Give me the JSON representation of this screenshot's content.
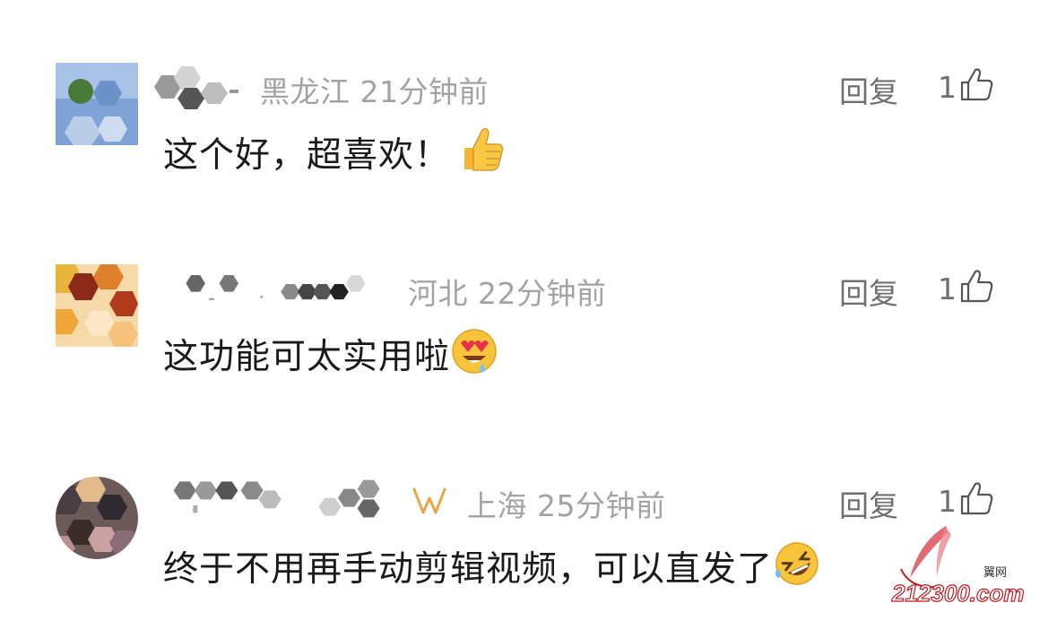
{
  "comments": [
    {
      "location": "黑龙江",
      "time": "21分钟前",
      "text": "这个好，超喜欢！",
      "emoji": "thumbs-up-emoji",
      "reply_label": "回复",
      "likes": "1"
    },
    {
      "location": "河北",
      "time": "22分钟前",
      "text": "这功能可太实用啦",
      "emoji": "heart-eyes-drooling-emoji",
      "reply_label": "回复",
      "likes": "1"
    },
    {
      "location": "上海",
      "time": "25分钟前",
      "text": "终于不用再手动剪辑视频，可以直发了",
      "emoji": "rolling-laughing-emoji",
      "reply_label": "回复",
      "likes": "1"
    }
  ],
  "watermark": {
    "top": "翼网",
    "bottom": "212300.com",
    "color": "#c8161d"
  },
  "colors": {
    "meta": "#a3a3a3",
    "text": "#1a1a1a",
    "action": "#6f6f6f",
    "vip": "#e8a64a"
  }
}
